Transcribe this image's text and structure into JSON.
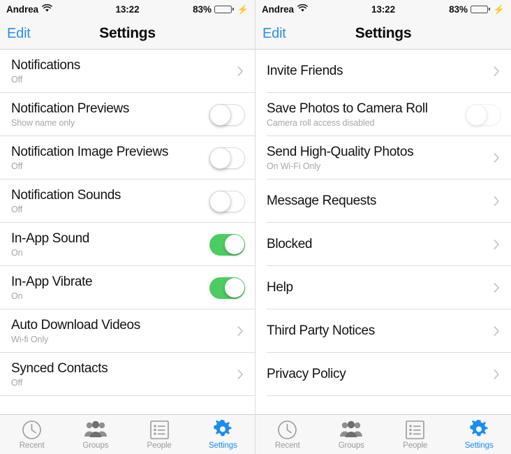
{
  "colors": {
    "accent_blue": "#1b8cf0",
    "edit_blue": "#2a8fe8",
    "toggle_on_green": "#4ccc62",
    "battery_green": "#4cd964",
    "separator": "#dcdcdc",
    "subtitle_gray": "#a6a6a6",
    "tab_inactive_gray": "#9a9a9a",
    "chrome_bg": "#f7f7f7"
  },
  "status_bar": {
    "carrier": "Andrea",
    "wifi_icon": "wifi-icon",
    "time": "13:22",
    "battery_percent": "83%",
    "battery_level": 83,
    "charging": true,
    "charging_icon": "lightning-bolt-icon"
  },
  "nav_bar": {
    "edit_label": "Edit",
    "title": "Settings"
  },
  "screens": [
    {
      "id": "settings-screen-notifications",
      "rows": [
        {
          "title": "Notifications",
          "subtitle": "Off",
          "control": "chevron"
        },
        {
          "title": "Notification Previews",
          "subtitle": "Show name only",
          "control": "toggle",
          "toggle_on": false,
          "toggle_disabled": false
        },
        {
          "title": "Notification Image Previews",
          "subtitle": "Off",
          "control": "toggle",
          "toggle_on": false,
          "toggle_disabled": false
        },
        {
          "title": "Notification Sounds",
          "subtitle": "Off",
          "control": "toggle",
          "toggle_on": false,
          "toggle_disabled": false
        },
        {
          "title": "In-App Sound",
          "subtitle": "On",
          "control": "toggle",
          "toggle_on": true,
          "toggle_disabled": false
        },
        {
          "title": "In-App Vibrate",
          "subtitle": "On",
          "control": "toggle",
          "toggle_on": true,
          "toggle_disabled": false
        },
        {
          "title": "Auto Download Videos",
          "subtitle": "Wi-fi Only",
          "control": "chevron"
        },
        {
          "title": "Synced Contacts",
          "subtitle": "Off",
          "control": "chevron"
        }
      ]
    },
    {
      "id": "settings-screen-general",
      "rows": [
        {
          "title": "Invite Friends",
          "subtitle": "",
          "control": "chevron"
        },
        {
          "title": "Save Photos to Camera Roll",
          "subtitle": "Camera roll access disabled",
          "control": "toggle",
          "toggle_on": false,
          "toggle_disabled": true
        },
        {
          "title": "Send High-Quality Photos",
          "subtitle": "On Wi-Fi Only",
          "control": "chevron"
        },
        {
          "title": "Message Requests",
          "subtitle": "",
          "control": "chevron"
        },
        {
          "title": "Blocked",
          "subtitle": "",
          "control": "chevron"
        },
        {
          "title": "Help",
          "subtitle": "",
          "control": "chevron"
        },
        {
          "title": "Third Party Notices",
          "subtitle": "",
          "control": "chevron"
        },
        {
          "title": "Privacy Policy",
          "subtitle": "",
          "control": "chevron"
        }
      ]
    }
  ],
  "tab_bar": {
    "tabs": [
      {
        "label": "Recent",
        "icon": "clock-icon",
        "active": false
      },
      {
        "label": "Groups",
        "icon": "people-group-icon",
        "active": false
      },
      {
        "label": "People",
        "icon": "list-icon",
        "active": false
      },
      {
        "label": "Settings",
        "icon": "gear-icon",
        "active": true
      }
    ]
  }
}
